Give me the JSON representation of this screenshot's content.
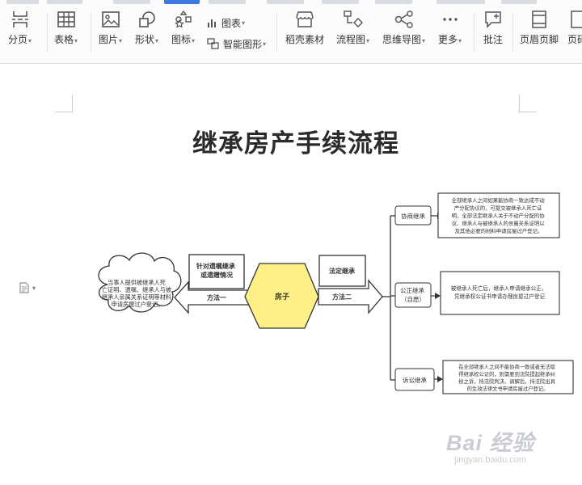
{
  "toolbar": {
    "buttons": {
      "paging": "分页",
      "table": "表格",
      "image": "图片",
      "shape": "形状",
      "icon": "图标",
      "chart": "图表",
      "smart_shape": "智能图形",
      "daoke": "稻壳素材",
      "flowchart": "流程图",
      "mindmap": "思维导图",
      "more": "更多",
      "comment": "批注",
      "header_footer": "页眉页脚",
      "page_number": "页码"
    }
  },
  "document": {
    "title": "继承房产手续流程",
    "watermark": {
      "main": "Bai 经验",
      "sub": "jingyan.baidu.com"
    }
  },
  "flowchart": {
    "cloud_text": [
      "当事人提供被继承人死",
      "亡证明、遗嘱、继承人与被",
      "继承人亲属关系证明等材料",
      "申请房屋过户登记。"
    ],
    "left_label": [
      "针对遗嘱继承",
      "或遗赠情况"
    ],
    "left_method": "方法一",
    "center": "房子",
    "right_label": "法定继承",
    "right_method": "方法二",
    "branches": [
      {
        "label": [
          "协商继承"
        ],
        "text": [
          "全部继承人之间如果能协商一致达成不动",
          "产分配协议的，可提交被继承人死亡证",
          "明、全部法定继承人关于不动产分配的协",
          "议、继承人与被继承人的亲属关系证明以",
          "及其他必要的材料申请房屋过户登记。"
        ]
      },
      {
        "label": [
          "公正继承",
          "（自愿）"
        ],
        "text": [
          "被继承人死亡后，继承人申请继承公正，",
          "凭继承权公证书申请办理房屋过户登记"
        ]
      },
      {
        "label": [
          "诉讼继承"
        ],
        "text": [
          "在全部继承人之间不能协商一致或者无法取",
          "得继承权公证的，则需要到法院提起继承纠",
          "纷之诉，持法院判决、调解后，持法院出具",
          "的生效法律文书申请房屋过户登记。"
        ]
      }
    ]
  }
}
